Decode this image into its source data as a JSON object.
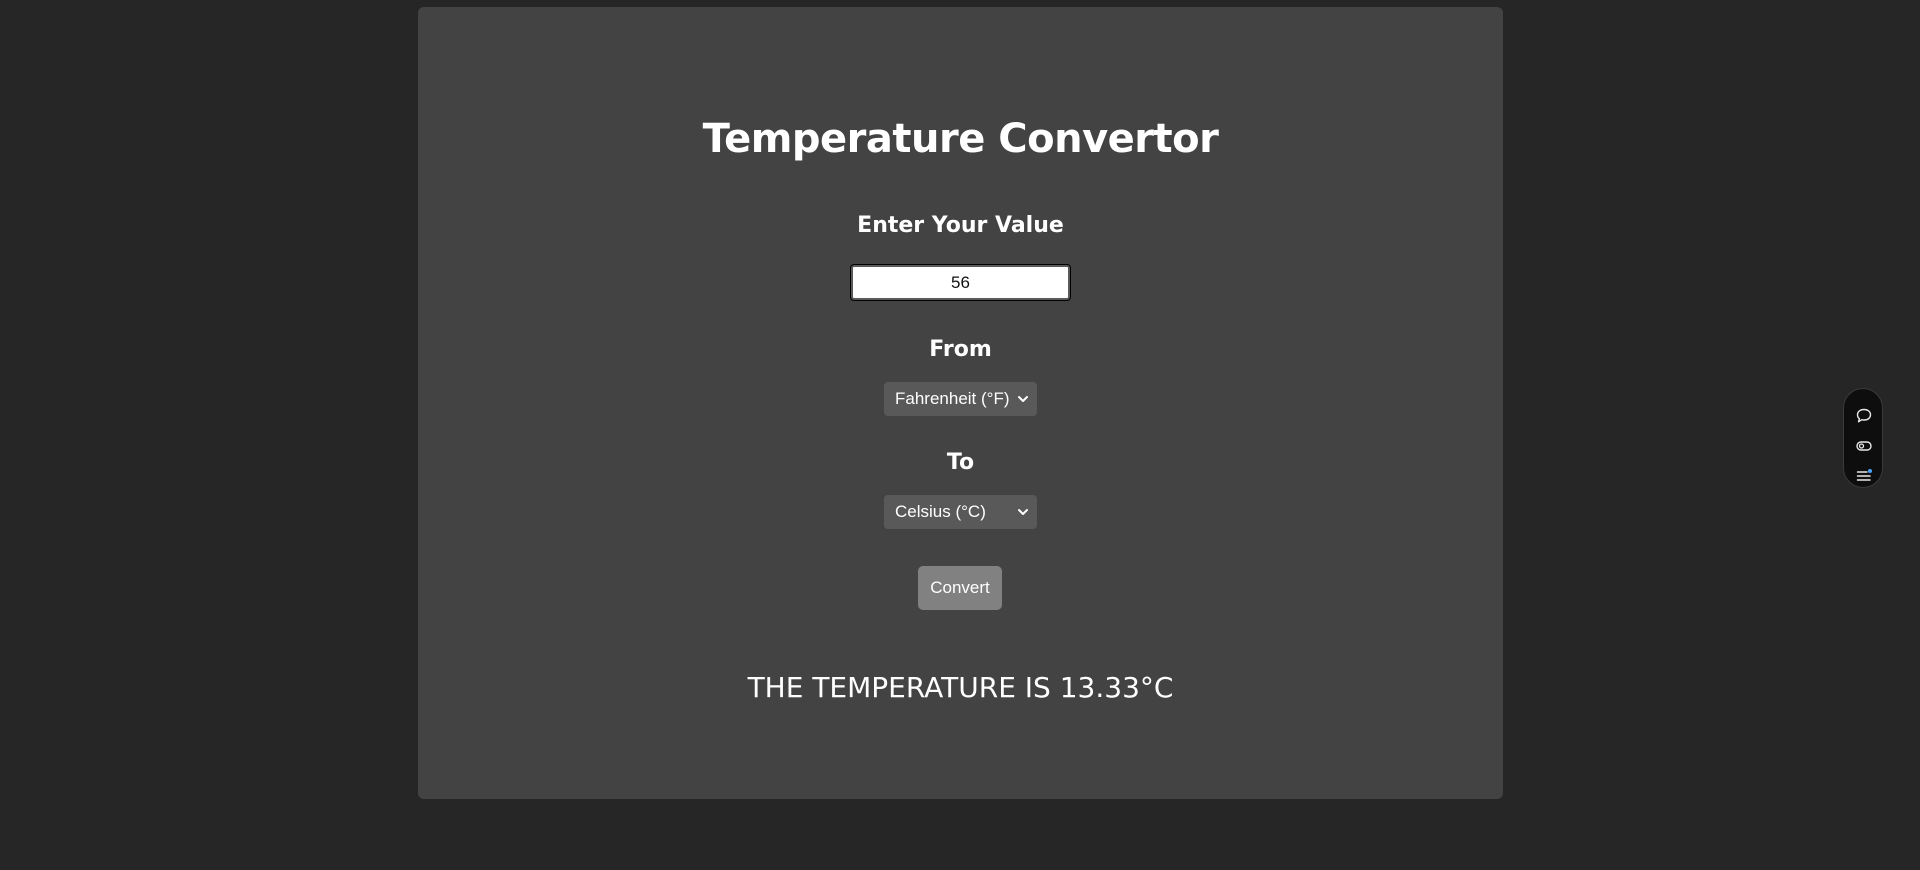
{
  "app": {
    "title": "Temperature Convertor"
  },
  "form": {
    "value_label": "Enter Your Value",
    "value": "56",
    "from_label": "From",
    "from_selected": "Fahrenheit (°F)",
    "to_label": "To",
    "to_selected": "Celsius (°C)",
    "convert_label": "Convert"
  },
  "result": {
    "text": "THE TEMPERATURE IS 13.33°C"
  },
  "floating_toolbar": {
    "icons": [
      "chat-icon",
      "toggle-icon",
      "list-icon"
    ]
  },
  "colors": {
    "page_bg": "#262626",
    "card_bg": "#434343",
    "select_bg": "#595959",
    "button_bg": "#818181",
    "accent_dot": "#4aa3ff"
  }
}
